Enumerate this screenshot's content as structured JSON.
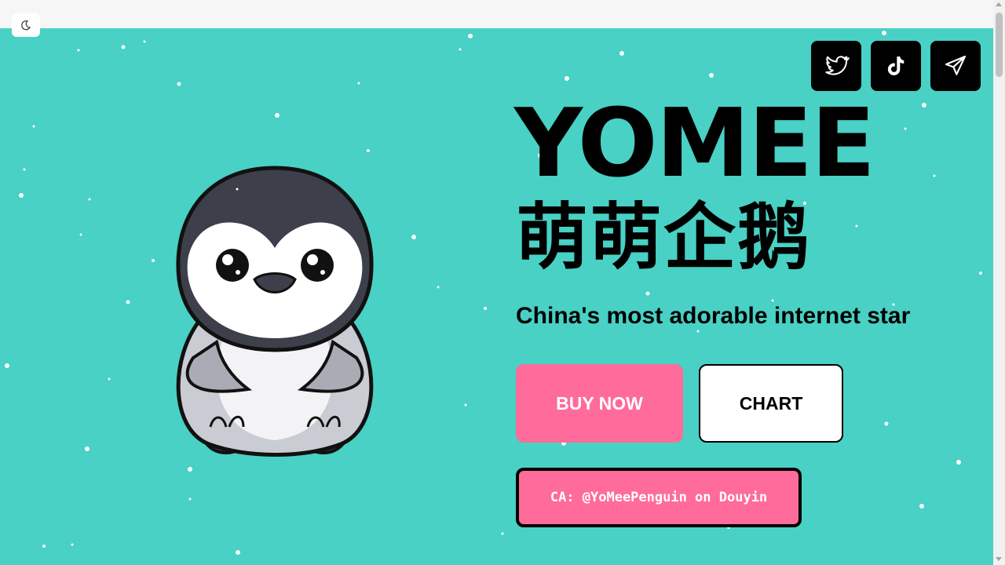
{
  "header": {
    "theme_toggle_icon": "moon-icon"
  },
  "social": [
    {
      "name": "twitter",
      "icon": "twitter-bird-icon"
    },
    {
      "name": "tiktok",
      "icon": "tiktok-icon"
    },
    {
      "name": "telegram",
      "icon": "telegram-paper-plane-icon"
    }
  ],
  "hero": {
    "title": "YOMEE",
    "chinese_name": "萌萌企鹅",
    "tagline": "China's most adorable internet star",
    "buy_label": "BUY NOW",
    "chart_label": "CHART",
    "contract_text": "CA: @YoMeePenguin on Douyin"
  },
  "colors": {
    "background": "#48d1c4",
    "accent_pink": "#ff6b9b",
    "text": "#000000",
    "snow": "#ffffff"
  }
}
